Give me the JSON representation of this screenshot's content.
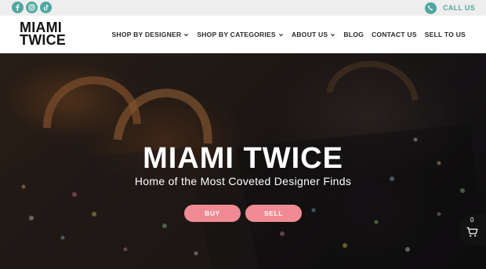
{
  "topbar": {
    "socials": [
      {
        "icon": "facebook-icon"
      },
      {
        "icon": "instagram-icon"
      },
      {
        "icon": "tiktok-icon"
      }
    ],
    "call_label": "CALL US",
    "accent_color": "#4fa7a0"
  },
  "header": {
    "logo": {
      "line1": "MIAMI",
      "line2": "TWICE"
    },
    "nav": [
      {
        "label": "SHOP BY DESIGNER",
        "dropdown": true
      },
      {
        "label": "SHOP BY CATEGORIES",
        "dropdown": true
      },
      {
        "label": "ABOUT US",
        "dropdown": true
      },
      {
        "label": "BLOG",
        "dropdown": false
      },
      {
        "label": "CONTACT US",
        "dropdown": false
      },
      {
        "label": "SELL TO US",
        "dropdown": false
      }
    ]
  },
  "hero": {
    "title": "MIAMI TWICE",
    "subtitle": "Home of the Most Coveted Designer Finds",
    "buy_label": "BUY",
    "sell_label": "SELL",
    "button_color": "#f08a93"
  },
  "cart": {
    "count": "0"
  }
}
